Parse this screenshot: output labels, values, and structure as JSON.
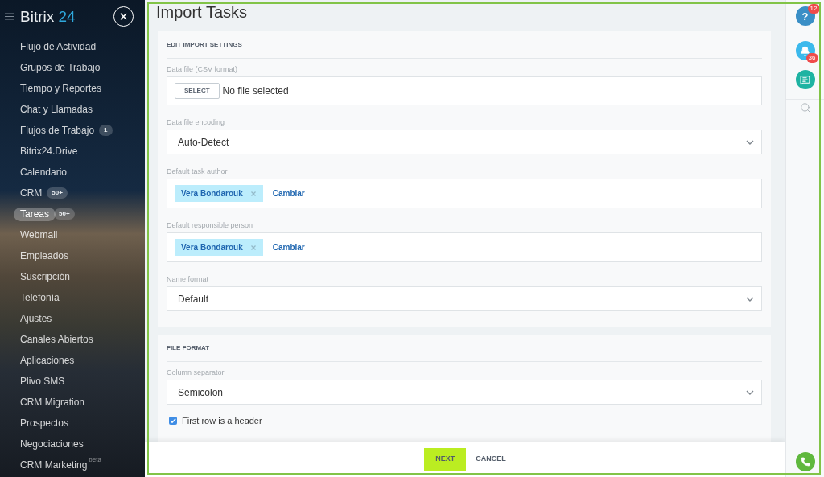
{
  "sidebar": {
    "logo": {
      "word": "Bitrix",
      "number": "24"
    },
    "items": [
      {
        "label": "Flujo de Actividad",
        "selected": false
      },
      {
        "label": "Grupos de Trabajo",
        "selected": false
      },
      {
        "label": "Tiempo y Reportes",
        "selected": false
      },
      {
        "label": "Chat y Llamadas",
        "selected": false
      },
      {
        "label": "Flujos de Trabajo",
        "counter": "1",
        "selected": false
      },
      {
        "label": "Bitrix24.Drive",
        "selected": false
      },
      {
        "label": "Calendario",
        "selected": false
      },
      {
        "label": "CRM",
        "counter": "50+",
        "selected": false
      },
      {
        "label": "Tareas",
        "counter": "50+",
        "selected": true
      },
      {
        "label": "Webmail",
        "selected": false
      },
      {
        "label": "Empleados",
        "selected": false
      },
      {
        "label": "Suscripción",
        "selected": false
      },
      {
        "label": "Telefonía",
        "selected": false
      },
      {
        "label": "Ajustes",
        "selected": false
      },
      {
        "label": "Canales Abiertos",
        "selected": false
      },
      {
        "label": "Aplicaciones",
        "selected": false
      },
      {
        "label": "Plivo SMS",
        "selected": false
      },
      {
        "label": "CRM Migration",
        "selected": false
      },
      {
        "label": "Prospectos",
        "selected": false
      },
      {
        "label": "Negociaciones",
        "selected": false
      },
      {
        "label": "CRM Marketing",
        "tag": "beta",
        "selected": false
      }
    ]
  },
  "page": {
    "title": "Import Tasks"
  },
  "sections": [
    {
      "title": "EDIT IMPORT SETTINGS",
      "fields": [
        {
          "kind": "file",
          "label": "Data file (CSV format)",
          "button": "SELECT",
          "value": "No file selected"
        },
        {
          "kind": "select",
          "label": "Data file encoding",
          "value": "Auto-Detect"
        },
        {
          "kind": "user",
          "label": "Default task author",
          "user": "Vera Bondarouk",
          "link": "Cambiar"
        },
        {
          "kind": "user",
          "label": "Default responsible person",
          "user": "Vera Bondarouk",
          "link": "Cambiar"
        },
        {
          "kind": "select",
          "label": "Name format",
          "value": "Default"
        }
      ]
    },
    {
      "title": "FILE FORMAT",
      "fields": [
        {
          "kind": "select",
          "label": "Column separator",
          "value": "Semicolon"
        },
        {
          "kind": "checkbox",
          "label": "First row is a header",
          "checked": true
        }
      ]
    }
  ],
  "footer": {
    "buttons": [
      {
        "kind": "primary",
        "label": "NEXT"
      },
      {
        "kind": "link",
        "label": "CANCEL"
      }
    ]
  },
  "right_panel": {
    "items": [
      {
        "kind": "help",
        "symbol": "?",
        "badge": "12"
      },
      {
        "kind": "bell",
        "badge": "36"
      },
      {
        "kind": "chat"
      },
      {
        "kind": "search"
      }
    ]
  }
}
